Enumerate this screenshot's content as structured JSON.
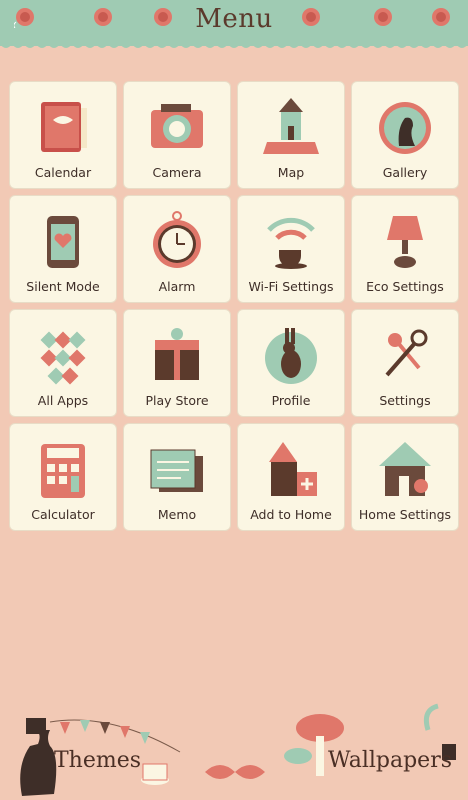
{
  "header": {
    "title": "Menu"
  },
  "apps": [
    {
      "label": "Calendar",
      "icon": "calendar-icon"
    },
    {
      "label": "Camera",
      "icon": "camera-icon"
    },
    {
      "label": "Map",
      "icon": "map-icon"
    },
    {
      "label": "Gallery",
      "icon": "gallery-icon"
    },
    {
      "label": "Silent Mode",
      "icon": "silent-mode-icon"
    },
    {
      "label": "Alarm",
      "icon": "alarm-clock-icon"
    },
    {
      "label": "Wi-Fi Settings",
      "icon": "wifi-icon"
    },
    {
      "label": "Eco Settings",
      "icon": "lamp-icon"
    },
    {
      "label": "All Apps",
      "icon": "all-apps-icon"
    },
    {
      "label": "Play Store",
      "icon": "gift-box-icon"
    },
    {
      "label": "Profile",
      "icon": "rabbit-icon"
    },
    {
      "label": "Settings",
      "icon": "keys-icon"
    },
    {
      "label": "Calculator",
      "icon": "calculator-icon"
    },
    {
      "label": "Memo",
      "icon": "memo-icon"
    },
    {
      "label": "Add to Home",
      "icon": "house-add-icon"
    },
    {
      "label": "Home Settings",
      "icon": "home-settings-icon"
    }
  ],
  "footer": {
    "themes": "Themes",
    "wallpapers": "Wallpapers"
  },
  "colors": {
    "background": "#f2c9b5",
    "header": "#9fcbb3",
    "tile": "#fbf6e3",
    "accent": "#e0776a",
    "brown": "#5b3a2c"
  }
}
